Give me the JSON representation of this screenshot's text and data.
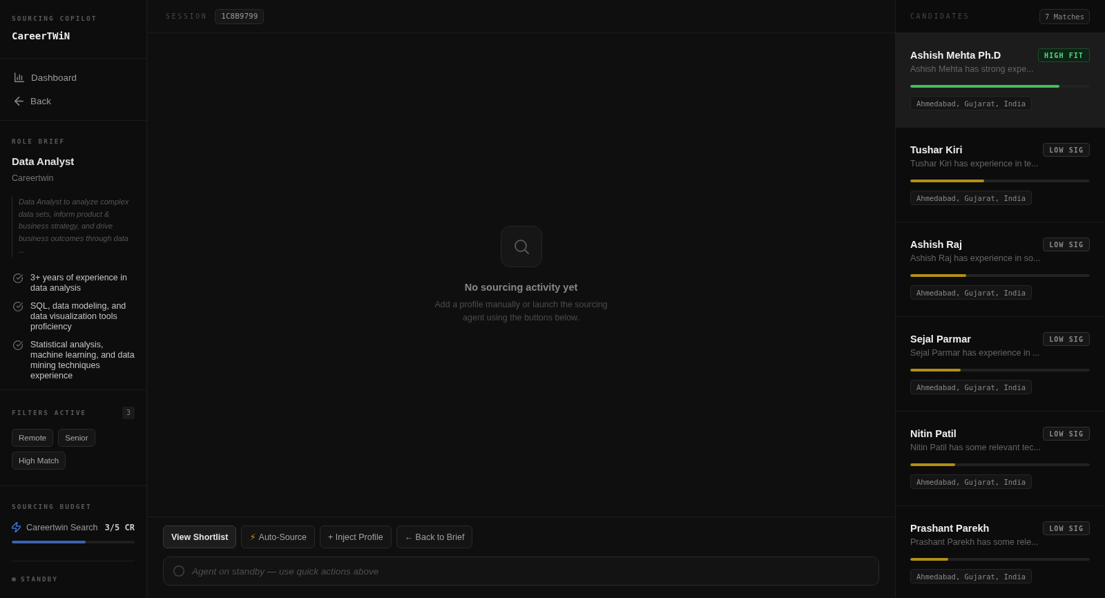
{
  "sidebar": {
    "eyebrow": "SOURCING COPILOT",
    "brand": "CareerTWiN",
    "nav": [
      {
        "label": "Dashboard",
        "kind": "dashboard"
      },
      {
        "label": "Back",
        "kind": "back"
      }
    ],
    "role_brief": {
      "heading": "ROLE BRIEF",
      "title": "Data Analyst",
      "company": "Careertwin",
      "description": "Data Analyst to analyze complex data sets, inform product & business strategy, and drive business outcomes through data ...",
      "requirements": [
        "3+ years of experience in data analysis",
        "SQL, data modeling, and data visualization tools proficiency",
        "Statistical analysis, machine learning, and data mining techniques experience"
      ]
    },
    "filters": {
      "heading": "FILTERS ACTIVE",
      "count": "3",
      "chips": [
        "Remote",
        "Senior",
        "High Match"
      ]
    },
    "budget": {
      "heading": "SOURCING BUDGET",
      "source": "Careertwin Search",
      "credits": "3/5 CR",
      "level": 0.6
    },
    "status": {
      "label": "STANDBY"
    }
  },
  "session": {
    "label": "SESSION",
    "id": "1C8B9799"
  },
  "empty_state": {
    "title": "No sourcing activity yet",
    "message": "Add a profile manually or launch the sourcing agent using the buttons below."
  },
  "quick_actions": [
    {
      "label": "View Shortlist",
      "primary": true
    },
    {
      "glyph": "⚡",
      "label": "Auto-Source",
      "primary": false
    },
    {
      "label": "+ Inject Profile",
      "primary": false
    },
    {
      "label": "← Back to Brief",
      "primary": false
    }
  ],
  "composer": {
    "placeholder": "Agent on standby — use quick actions above"
  },
  "candidates": {
    "heading": "CANDIDATES",
    "count": "7 Matches",
    "items": [
      {
        "name": "Ashish Mehta Ph.D",
        "badge": "HIGH FIT",
        "kind": "high",
        "summary": "Ashish Mehta has strong expe...",
        "level": 0.83,
        "location": "Ahmedabad, Gujarat, India",
        "selected": true
      },
      {
        "name": "Tushar Kiri",
        "badge": "LOW SIG",
        "kind": "low",
        "summary": "Tushar Kiri has experience in te...",
        "level": 0.41,
        "location": "Ahmedabad, Gujarat, India",
        "selected": false
      },
      {
        "name": "Ashish Raj",
        "badge": "LOW SIG",
        "kind": "low",
        "summary": "Ashish Raj has experience in so...",
        "level": 0.31,
        "location": "Ahmedabad, Gujarat, India",
        "selected": false
      },
      {
        "name": "Sejal Parmar",
        "badge": "LOW SIG",
        "kind": "low",
        "summary": "Sejal Parmar has experience in ...",
        "level": 0.28,
        "location": "Ahmedabad, Gujarat, India",
        "selected": false
      },
      {
        "name": "Nitin Patil",
        "badge": "LOW SIG",
        "kind": "low",
        "summary": "Nitin Patil has some relevant tec...",
        "level": 0.25,
        "location": "Ahmedabad, Gujarat, India",
        "selected": false
      },
      {
        "name": "Prashant Parekh",
        "badge": "LOW SIG",
        "kind": "low",
        "summary": "Prashant Parekh has some rele...",
        "level": 0.21,
        "location": "Ahmedabad, Gujarat, India",
        "selected": false
      }
    ]
  }
}
